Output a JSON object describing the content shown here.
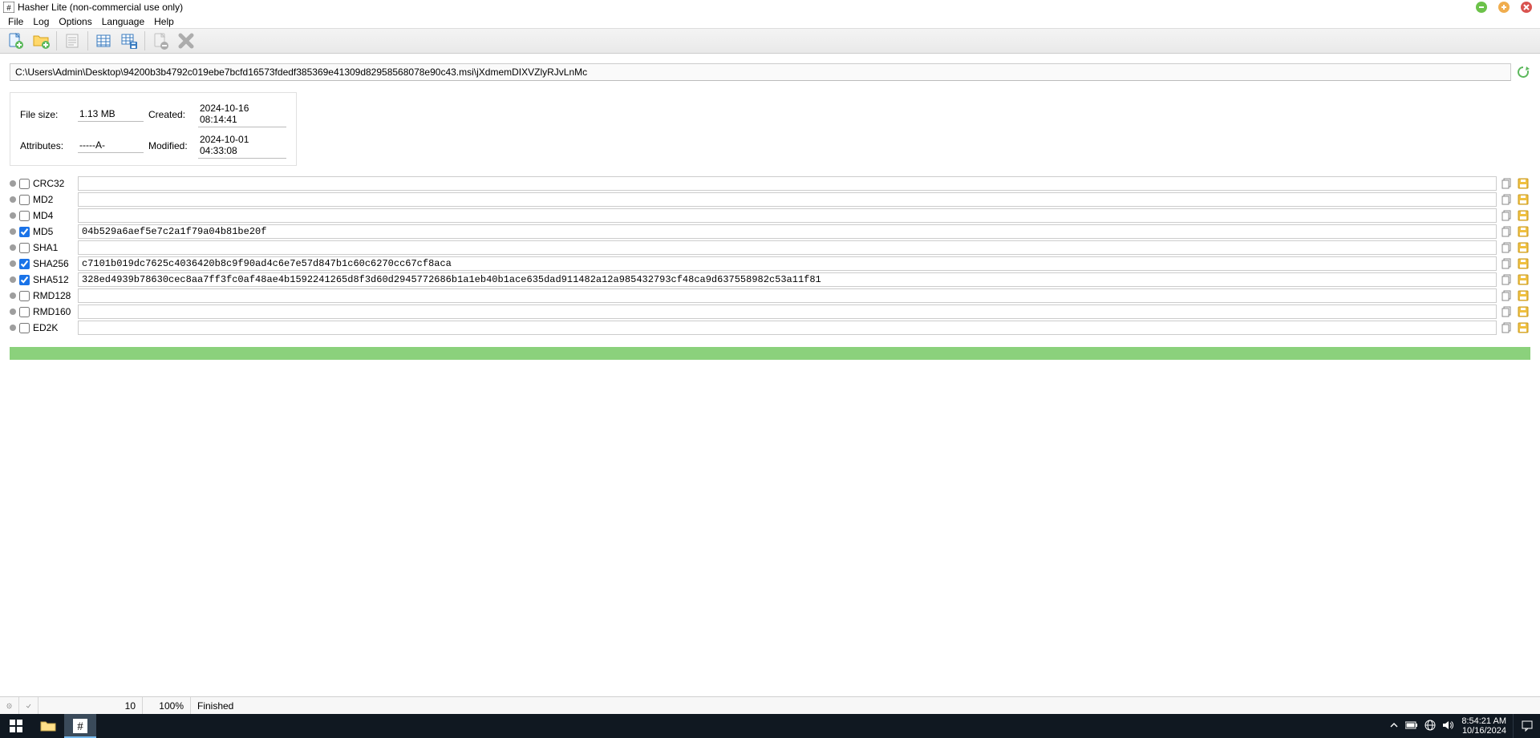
{
  "window": {
    "title": "Hasher Lite (non-commercial use only)"
  },
  "menu": {
    "file": "File",
    "log": "Log",
    "options": "Options",
    "language": "Language",
    "help": "Help"
  },
  "path": {
    "value": "C:\\Users\\Admin\\Desktop\\94200b3b4792c019ebe7bcfd16573fdedf385369e41309d82958568078e90c43.msi\\jXdmemDIXVZlyRJvLnMc"
  },
  "info": {
    "filesize_label": "File size:",
    "filesize_value": "1.13 MB",
    "attributes_label": "Attributes:",
    "attributes_value": "-----A-",
    "created_label": "Created:",
    "created_value": "2024-10-16 08:14:41",
    "modified_label": "Modified:",
    "modified_value": "2024-10-01 04:33:08"
  },
  "algorithms": [
    {
      "name": "CRC32",
      "checked": false,
      "value": ""
    },
    {
      "name": "MD2",
      "checked": false,
      "value": ""
    },
    {
      "name": "MD4",
      "checked": false,
      "value": ""
    },
    {
      "name": "MD5",
      "checked": true,
      "value": "04b529a6aef5e7c2a1f79a04b81be20f"
    },
    {
      "name": "SHA1",
      "checked": false,
      "value": ""
    },
    {
      "name": "SHA256",
      "checked": true,
      "value": "c7101b019dc7625c4036420b8c9f90ad4c6e7e57d847b1c60c6270cc67cf8aca"
    },
    {
      "name": "SHA512",
      "checked": true,
      "value": "328ed4939b78630cec8aa7ff3fc0af48ae4b1592241265d8f3d60d2945772686b1a1eb40b1ace635dad911482a12a985432793cf48ca9d637558982c53a11f81"
    },
    {
      "name": "RMD128",
      "checked": false,
      "value": ""
    },
    {
      "name": "RMD160",
      "checked": false,
      "value": ""
    },
    {
      "name": "ED2K",
      "checked": false,
      "value": ""
    }
  ],
  "status": {
    "count": "10",
    "percent": "100%",
    "state": "Finished"
  },
  "taskbar": {
    "time": "8:54:21 AM",
    "date": "10/16/2024"
  }
}
